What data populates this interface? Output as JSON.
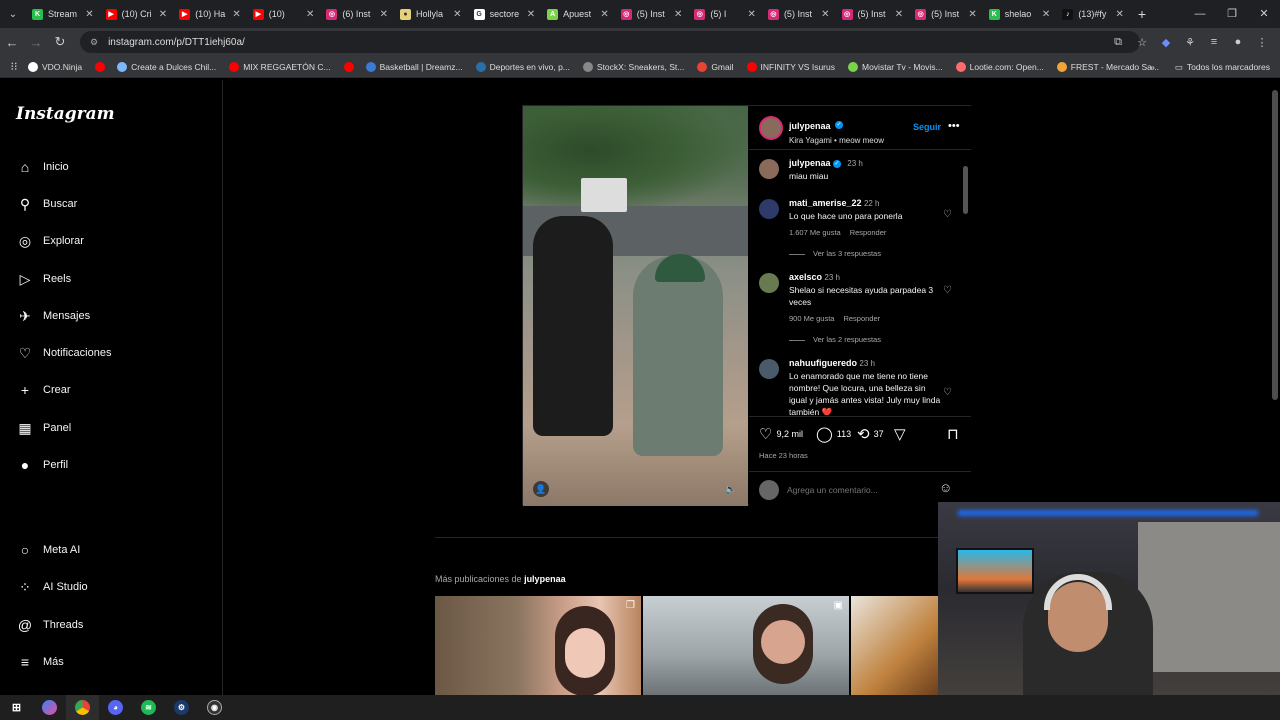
{
  "browser": {
    "tabs": [
      {
        "title": "Stream",
        "color": "#2bbd4e",
        "icon": "K"
      },
      {
        "title": "(10) Cri",
        "color": "#ff0000",
        "icon": "▶"
      },
      {
        "title": "(10) Ha",
        "color": "#ff0000",
        "icon": "▶"
      },
      {
        "title": "(10) ",
        "color": "#ff0000",
        "icon": "▶"
      },
      {
        "title": "(6) Inst",
        "color": "#d62976",
        "icon": "◎"
      },
      {
        "title": "Hollyla",
        "color": "#e6d27a",
        "icon": "●"
      },
      {
        "title": "sectore",
        "color": "#ffffff",
        "icon": "G"
      },
      {
        "title": "Apuest",
        "color": "#7bd34a",
        "icon": "A"
      },
      {
        "title": "(5) Inst",
        "color": "#d62976",
        "icon": "◎"
      },
      {
        "title": "(5) I",
        "color": "#d62976",
        "icon": "◎"
      },
      {
        "title": "(5) Inst",
        "color": "#d62976",
        "icon": "◎"
      },
      {
        "title": "(5) Inst",
        "color": "#d62976",
        "icon": "◎"
      },
      {
        "title": "(5) Inst",
        "color": "#d62976",
        "icon": "◎"
      },
      {
        "title": "shelao",
        "color": "#2bbd4e",
        "icon": "K"
      },
      {
        "title": "(13)#fy",
        "color": "#111111",
        "icon": "♪"
      }
    ],
    "url": "instagram.com/p/DTT1iehj60a/",
    "bookmarks": [
      {
        "label": "VDO.Ninja",
        "color": "#ffffff"
      },
      {
        "label": "",
        "color": "#ff0000"
      },
      {
        "label": "Create a Dulces Chil...",
        "color": "#7fb7ff"
      },
      {
        "label": "MIX REGGAETÓN C...",
        "color": "#ff0000"
      },
      {
        "label": "",
        "color": "#ff0000"
      },
      {
        "label": "Basketball | Dreamz...",
        "color": "#3a7bd5"
      },
      {
        "label": "Deportes en vivo, p...",
        "color": "#2a6fa8"
      },
      {
        "label": "StockX: Sneakers, St...",
        "color": "#888888"
      },
      {
        "label": "Gmail",
        "color": "#ea4335"
      },
      {
        "label": "INFINITY VS Isurus",
        "color": "#ff0000"
      },
      {
        "label": "Movistar Tv - Movis...",
        "color": "#7bd34a"
      },
      {
        "label": "Lootie.com: Open...",
        "color": "#ff6b6b"
      },
      {
        "label": "FREST - Mercado Sa...",
        "color": "#f2a33a"
      }
    ],
    "bookmarks_all": "Todos los marcadores"
  },
  "sidebar": {
    "logo": "Instagram",
    "items": [
      {
        "label": "Inicio",
        "icon": "home-icon",
        "glyph": "⌂"
      },
      {
        "label": "Buscar",
        "icon": "search-icon",
        "glyph": "⚲"
      },
      {
        "label": "Explorar",
        "icon": "compass-icon",
        "glyph": "◎"
      },
      {
        "label": "Reels",
        "icon": "reels-icon",
        "glyph": "▷"
      },
      {
        "label": "Mensajes",
        "icon": "messenger-icon",
        "glyph": "✈",
        "badge": "5"
      },
      {
        "label": "Notificaciones",
        "icon": "heart-icon",
        "glyph": "♡"
      },
      {
        "label": "Crear",
        "icon": "plus-icon",
        "glyph": "+"
      },
      {
        "label": "Panel",
        "icon": "dashboard-icon",
        "glyph": "▦"
      },
      {
        "label": "Perfil",
        "icon": "avatar-icon",
        "glyph": "●"
      }
    ],
    "bottom": [
      {
        "label": "Meta AI",
        "icon": "meta-ai-icon",
        "glyph": "○"
      },
      {
        "label": "AI Studio",
        "icon": "ai-studio-icon",
        "glyph": "⁘"
      },
      {
        "label": "Threads",
        "icon": "threads-icon",
        "glyph": "@",
        "badge": "9+"
      },
      {
        "label": "Más",
        "icon": "menu-icon",
        "glyph": "≡"
      }
    ]
  },
  "post": {
    "author": "julypenaa",
    "subtitle": "Kira Yagami • meow meow",
    "follow": "Seguir",
    "caption": {
      "user": "julypenaa",
      "time": "23 h",
      "text": "miau miau"
    },
    "comments": [
      {
        "user": "mati_amerise_22",
        "time": "22 h",
        "text": "Lo que hace uno para ponerla",
        "likes": "1.607 Me gusta",
        "reply": "Responder",
        "replies": "Ver las 3 respuestas"
      },
      {
        "user": "axelsco",
        "time": "23 h",
        "text": "Shelao si necesitas ayuda parpadea 3 veces",
        "likes": "900 Me gusta",
        "reply": "Responder",
        "replies": "Ver las 2 respuestas"
      },
      {
        "user": "nahuufigueredo",
        "time": "23 h",
        "text": "Lo enamorado que me tiene no tiene nombre! Que locura, una belleza sin igual y jamás antes vista! July muy linda también ❤️"
      }
    ],
    "likes": "9,2 mil",
    "comments_count": "113",
    "reposts": "37",
    "ago": "Hace 23 horas",
    "add_comment_placeholder": "Agrega un comentario..."
  },
  "more": {
    "prefix": "Más publicaciones de ",
    "user": "julypenaa"
  }
}
